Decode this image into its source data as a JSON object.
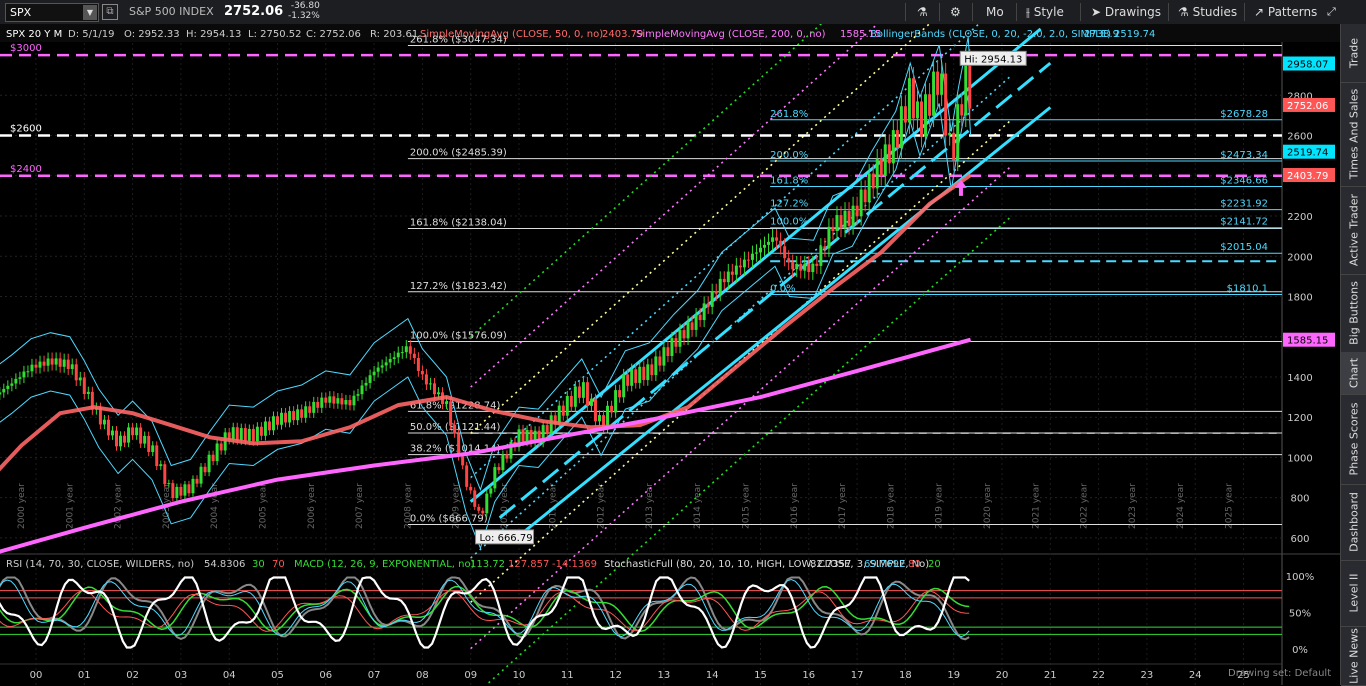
{
  "toolbar": {
    "symbol": "SPX",
    "name": "S&P 500 INDEX",
    "price": "2752.06",
    "change": "-36.80",
    "change_pct": "-1.32%",
    "timeframe": "Mo",
    "style": "Style",
    "drawings": "Drawings",
    "studies": "Studies",
    "patterns": "Patterns"
  },
  "sidebar": [
    "Trade",
    "Times And Sales",
    "Active Trader",
    "Big Buttons",
    "Chart",
    "Phase Scores",
    "Dashboard",
    "Level II",
    "Live News"
  ],
  "header": {
    "period": "SPX 20 Y M",
    "date": "D: 5/1/19",
    "open": "O: 2952.33",
    "high": "H: 2954.13",
    "low": "L: 2750.52",
    "close": "C: 2752.06",
    "range": "R: 203.61",
    "sma50": "SimpleMovingAvg (CLOSE, 50, 0, no)",
    "sma50_val": "2403.79",
    "sma200": "SimpleMovingAvg (CLOSE, 200, 0, no)",
    "sma200_val": "1585.15",
    "bb": "BollingerBands (CLOSE, 0, 20, -2.0, 2.0, SIMPLE)",
    "bb_upper": "2738.9",
    "bb_lower": "2519.74"
  },
  "lower_header": {
    "rsi": "RSI (14, 70, 30, CLOSE, WILDERS, no)",
    "rsi_val": "54.8306",
    "rsi_ob": "30",
    "rsi_os": "70",
    "macd": "MACD (12, 26, 9, EXPONENTIAL, no)",
    "macd_v1": "113.72",
    "macd_v2": "127.857",
    "macd_v3": "-14.1369",
    "stoch": "StochasticFull (80, 20, 10, 10, HIGH, LOW, CLOSE, 3, SIMPLE, No)",
    "stoch_v1": "82.7357",
    "stoch_v2": "69.7692",
    "stoch_ob": "80",
    "stoch_os": "20"
  },
  "lower_axis": [
    "100%",
    "50%",
    "0%"
  ],
  "drawing_set": "Drawing set: Default",
  "chart_data": {
    "type": "candlestick",
    "y_ticks": [
      600,
      800,
      1000,
      1200,
      1400,
      1600,
      1800,
      2000,
      2200,
      2400,
      2600,
      2800
    ],
    "x_years": [
      "00",
      "01",
      "02",
      "03",
      "04",
      "05",
      "06",
      "07",
      "08",
      "09",
      "10",
      "11",
      "12",
      "13",
      "14",
      "15",
      "16",
      "17",
      "18",
      "19",
      "20",
      "21",
      "22",
      "23",
      "24",
      "25"
    ],
    "year_labels": [
      "1999 year",
      "2000 year",
      "2001 year",
      "2002 year",
      "2003 year",
      "2004 year",
      "2005 year",
      "2006 year",
      "2007 year",
      "2008 year",
      "2009 year",
      "2010 year",
      "2011 year",
      "2012 year",
      "2013 year",
      "2014 year",
      "2015 year",
      "2016 year",
      "2017 year",
      "2018 year",
      "2019 year",
      "2020 year",
      "2021 year",
      "2022 year",
      "2023 year",
      "2024 year",
      "2025 year"
    ],
    "price_path": [
      [
        1999.0,
        1280
      ],
      [
        1999.5,
        1370
      ],
      [
        1999.9,
        1450
      ],
      [
        2000.3,
        1480
      ],
      [
        2000.7,
        1460
      ],
      [
        2001.0,
        1340
      ],
      [
        2001.3,
        1200
      ],
      [
        2001.7,
        1070
      ],
      [
        2002.0,
        1140
      ],
      [
        2002.4,
        1040
      ],
      [
        2002.8,
        820
      ],
      [
        2003.2,
        850
      ],
      [
        2003.6,
        990
      ],
      [
        2004.0,
        1120
      ],
      [
        2004.5,
        1110
      ],
      [
        2005.0,
        1190
      ],
      [
        2005.5,
        1220
      ],
      [
        2006.0,
        1290
      ],
      [
        2006.5,
        1270
      ],
      [
        2007.0,
        1430
      ],
      [
        2007.7,
        1550
      ],
      [
        2008.0,
        1400
      ],
      [
        2008.5,
        1260
      ],
      [
        2008.9,
        880
      ],
      [
        2009.2,
        700
      ],
      [
        2009.5,
        930
      ],
      [
        2010.0,
        1110
      ],
      [
        2010.4,
        1100
      ],
      [
        2010.9,
        1240
      ],
      [
        2011.3,
        1350
      ],
      [
        2011.7,
        1160
      ],
      [
        2012.2,
        1390
      ],
      [
        2012.7,
        1430
      ],
      [
        2013.2,
        1570
      ],
      [
        2013.7,
        1690
      ],
      [
        2014.2,
        1880
      ],
      [
        2014.7,
        1980
      ],
      [
        2015.3,
        2100
      ],
      [
        2015.6,
        1950
      ],
      [
        2016.1,
        1940
      ],
      [
        2016.5,
        2160
      ],
      [
        2016.9,
        2200
      ],
      [
        2017.3,
        2380
      ],
      [
        2017.8,
        2580
      ],
      [
        2018.1,
        2820
      ],
      [
        2018.3,
        2650
      ],
      [
        2018.7,
        2910
      ],
      [
        2018.95,
        2480
      ],
      [
        2019.1,
        2700
      ],
      [
        2019.3,
        2950
      ],
      [
        2019.35,
        2752
      ]
    ],
    "sma50_path": [
      [
        1999.0,
        880
      ],
      [
        1999.7,
        1060
      ],
      [
        2000.5,
        1220
      ],
      [
        2001.2,
        1250
      ],
      [
        2002.0,
        1220
      ],
      [
        2002.8,
        1160
      ],
      [
        2003.6,
        1100
      ],
      [
        2004.5,
        1070
      ],
      [
        2005.5,
        1080
      ],
      [
        2006.5,
        1150
      ],
      [
        2007.5,
        1260
      ],
      [
        2008.5,
        1300
      ],
      [
        2009.5,
        1230
      ],
      [
        2010.5,
        1180
      ],
      [
        2011.5,
        1150
      ],
      [
        2012.5,
        1160
      ],
      [
        2013.5,
        1250
      ],
      [
        2014.5,
        1450
      ],
      [
        2015.5,
        1650
      ],
      [
        2016.5,
        1840
      ],
      [
        2017.5,
        2020
      ],
      [
        2018.5,
        2260
      ],
      [
        2019.35,
        2404
      ]
    ],
    "sma200_path": [
      [
        1999.0,
        515
      ],
      [
        2001.0,
        650
      ],
      [
        2003.0,
        780
      ],
      [
        2005.0,
        890
      ],
      [
        2007.0,
        960
      ],
      [
        2009.0,
        1020
      ],
      [
        2011.0,
        1110
      ],
      [
        2013.0,
        1200
      ],
      [
        2015.0,
        1300
      ],
      [
        2017.0,
        1430
      ],
      [
        2019.35,
        1585
      ]
    ],
    "fib_levels": [
      {
        "label": "261.8%  ($3047.34)",
        "price": 3047.34
      },
      {
        "label": "200.0%  ($2485.39)",
        "price": 2485.39
      },
      {
        "label": "161.8%  ($2138.04)",
        "price": 2138.04
      },
      {
        "label": "127.2%  ($1823.42)",
        "price": 1823.42
      },
      {
        "label": "100.0%  ($1576.09)",
        "price": 1576.09
      },
      {
        "label": "61.8%  ($1228.74)",
        "price": 1228.74
      },
      {
        "label": "50.0%  ($1121.44)",
        "price": 1121.44
      },
      {
        "label": "38.2%  ($1014.14)",
        "price": 1014.14
      },
      {
        "label": "0.0%  ($666.79)",
        "price": 666.79
      }
    ],
    "fib2_levels": [
      {
        "label": "261.8%",
        "right": "$2678.28",
        "price": 2678.28
      },
      {
        "label": "200.0%",
        "right": "$2473.34",
        "price": 2473.34
      },
      {
        "label": "161.8%",
        "right": "$2346.66",
        "price": 2346.66
      },
      {
        "label": "127.2%",
        "right": "$2231.92",
        "price": 2231.92
      },
      {
        "label": "100.0%",
        "right": "$2141.72",
        "price": 2141.72
      },
      {
        "label": "",
        "right": "$2015.04",
        "price": 2015.04
      },
      {
        "label": "0.0%",
        "right": "$1810.1",
        "price": 1810.1
      }
    ],
    "h_lines": [
      {
        "label": "$3000",
        "price": 3000,
        "color": "#ff66ff"
      },
      {
        "label": "$2600",
        "price": 2600,
        "color": "#ffffff"
      },
      {
        "label": "$2400",
        "price": 2400,
        "color": "#ff66ff"
      }
    ],
    "hi_label": "Hi: 2954.13",
    "lo_label": "Lo: 666.79",
    "price_tags": [
      {
        "text": "2958.07",
        "price": 2958.07,
        "bg": "#00e5ff",
        "fg": "#000"
      },
      {
        "text": "2752.06",
        "price": 2752.06,
        "bg": "#ff5555",
        "fg": "#fff"
      },
      {
        "text": "2519.74",
        "price": 2519.74,
        "bg": "#00e5ff",
        "fg": "#000"
      },
      {
        "text": "2403.79",
        "price": 2403.79,
        "bg": "#ff5555",
        "fg": "#fff"
      },
      {
        "text": "1585.15",
        "price": 1585.15,
        "bg": "#ff66ff",
        "fg": "#000"
      }
    ]
  }
}
